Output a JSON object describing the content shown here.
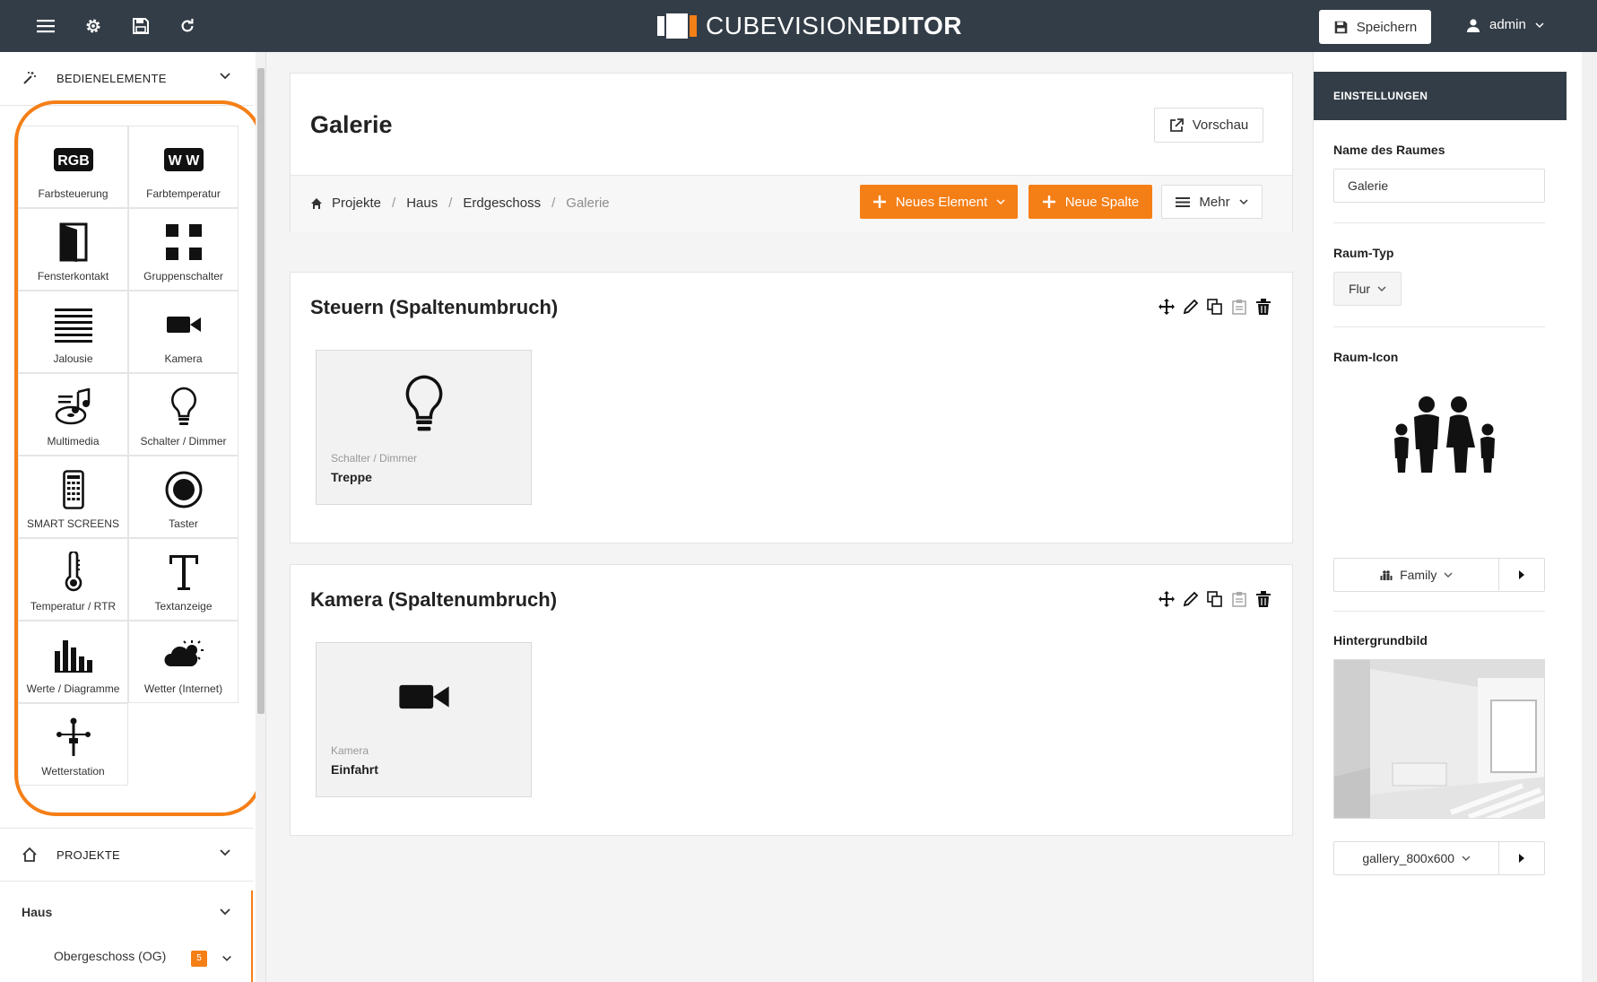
{
  "topbar": {
    "logo_light": "CUBEVISION",
    "logo_bold": "EDITOR",
    "save_label": "Speichern",
    "user_label": "admin",
    "icons": [
      "menu-icon",
      "gear-icon",
      "floppy-disk-icon",
      "refresh-icon"
    ]
  },
  "sidebar": {
    "section_title": "BEDIENELEMENTE",
    "elements": [
      {
        "label": "Farbsteuerung",
        "icon": "rgb-icon"
      },
      {
        "label": "Farbtemperatur",
        "icon": "ww-icon"
      },
      {
        "label": "Fensterkontakt",
        "icon": "window-contact-icon"
      },
      {
        "label": "Gruppenschalter",
        "icon": "grid-icon"
      },
      {
        "label": "Jalousie",
        "icon": "blinds-icon"
      },
      {
        "label": "Kamera",
        "icon": "video-camera-icon"
      },
      {
        "label": "Multimedia",
        "icon": "multimedia-icon"
      },
      {
        "label": "Schalter / Dimmer",
        "icon": "lightbulb-icon"
      },
      {
        "label": "SMART SCREENS",
        "icon": "smartphone-icon"
      },
      {
        "label": "Taster",
        "icon": "record-button-icon"
      },
      {
        "label": "Temperatur / RTR",
        "icon": "thermometer-icon"
      },
      {
        "label": "Textanzeige",
        "icon": "text-t-icon"
      },
      {
        "label": "Werte / Diagramme",
        "icon": "bar-chart-icon"
      },
      {
        "label": "Wetter (Internet)",
        "icon": "weather-icon"
      },
      {
        "label": "Wetterstation",
        "icon": "weather-station-icon"
      }
    ],
    "projects_title": "PROJEKTE",
    "tree_root": "Haus",
    "tree_child": "Obergeschoss (OG)",
    "tree_child_badge": "5"
  },
  "main": {
    "title": "Galerie",
    "preview_label": "Vorschau",
    "breadcrumb": [
      "Projekte",
      "Haus",
      "Erdgeschoss",
      "Galerie"
    ],
    "new_element_label": "Neues Element",
    "new_column_label": "Neue Spalte",
    "more_label": "Mehr",
    "sections": [
      {
        "title": "Steuern (Spaltenumbruch)",
        "card": {
          "type": "Schalter / Dimmer",
          "name": "Treppe"
        }
      },
      {
        "title": "Kamera (Spaltenumbruch)",
        "card": {
          "type": "Kamera",
          "name": "Einfahrt"
        }
      }
    ]
  },
  "settings": {
    "title": "EINSTELLUNGEN",
    "room_name_label": "Name des Raumes",
    "room_name_value": "Galerie",
    "room_type_label": "Raum-Typ",
    "room_type_value": "Flur",
    "room_icon_label": "Raum-Icon",
    "room_icon_value": "Family",
    "background_label": "Hintergrundbild",
    "background_value": "gallery_800x600"
  }
}
